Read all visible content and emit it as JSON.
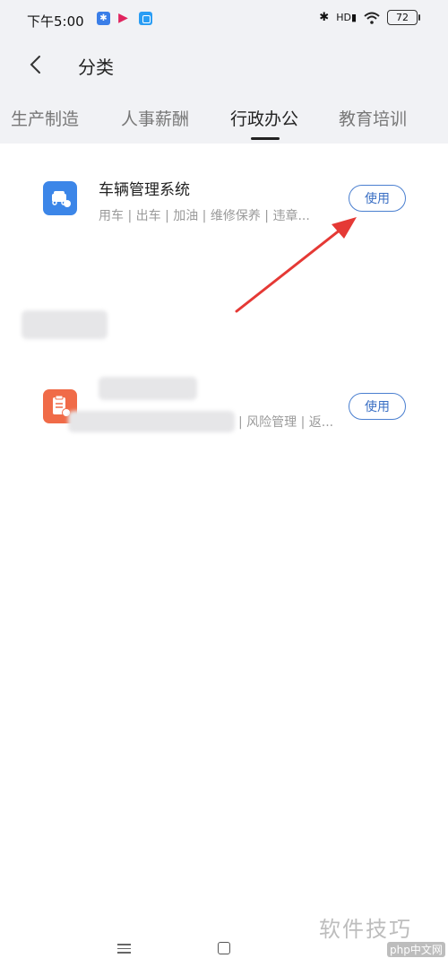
{
  "status_bar": {
    "time": "下午5:00",
    "hd": "HD",
    "battery": "72"
  },
  "header": {
    "title": "分类"
  },
  "tabs": [
    {
      "label": "生产制造"
    },
    {
      "label": "人事薪酬"
    },
    {
      "label": "行政办公"
    },
    {
      "label": "教育培训"
    }
  ],
  "items": [
    {
      "title": "车辆管理系统",
      "desc": "用车 | 出车 | 加油 | 维修保养 | 违章...",
      "button": "使用",
      "icon": "car-icon"
    },
    {
      "title": "",
      "desc": "| 风险管理 | 返...",
      "button": "使用",
      "icon": "clipboard-icon"
    }
  ],
  "watermark": {
    "text": "软件技巧",
    "logo": "php中文网"
  },
  "colors": {
    "accent": "#3c86e8",
    "orange": "#f06b48",
    "arrow": "#e53935"
  }
}
